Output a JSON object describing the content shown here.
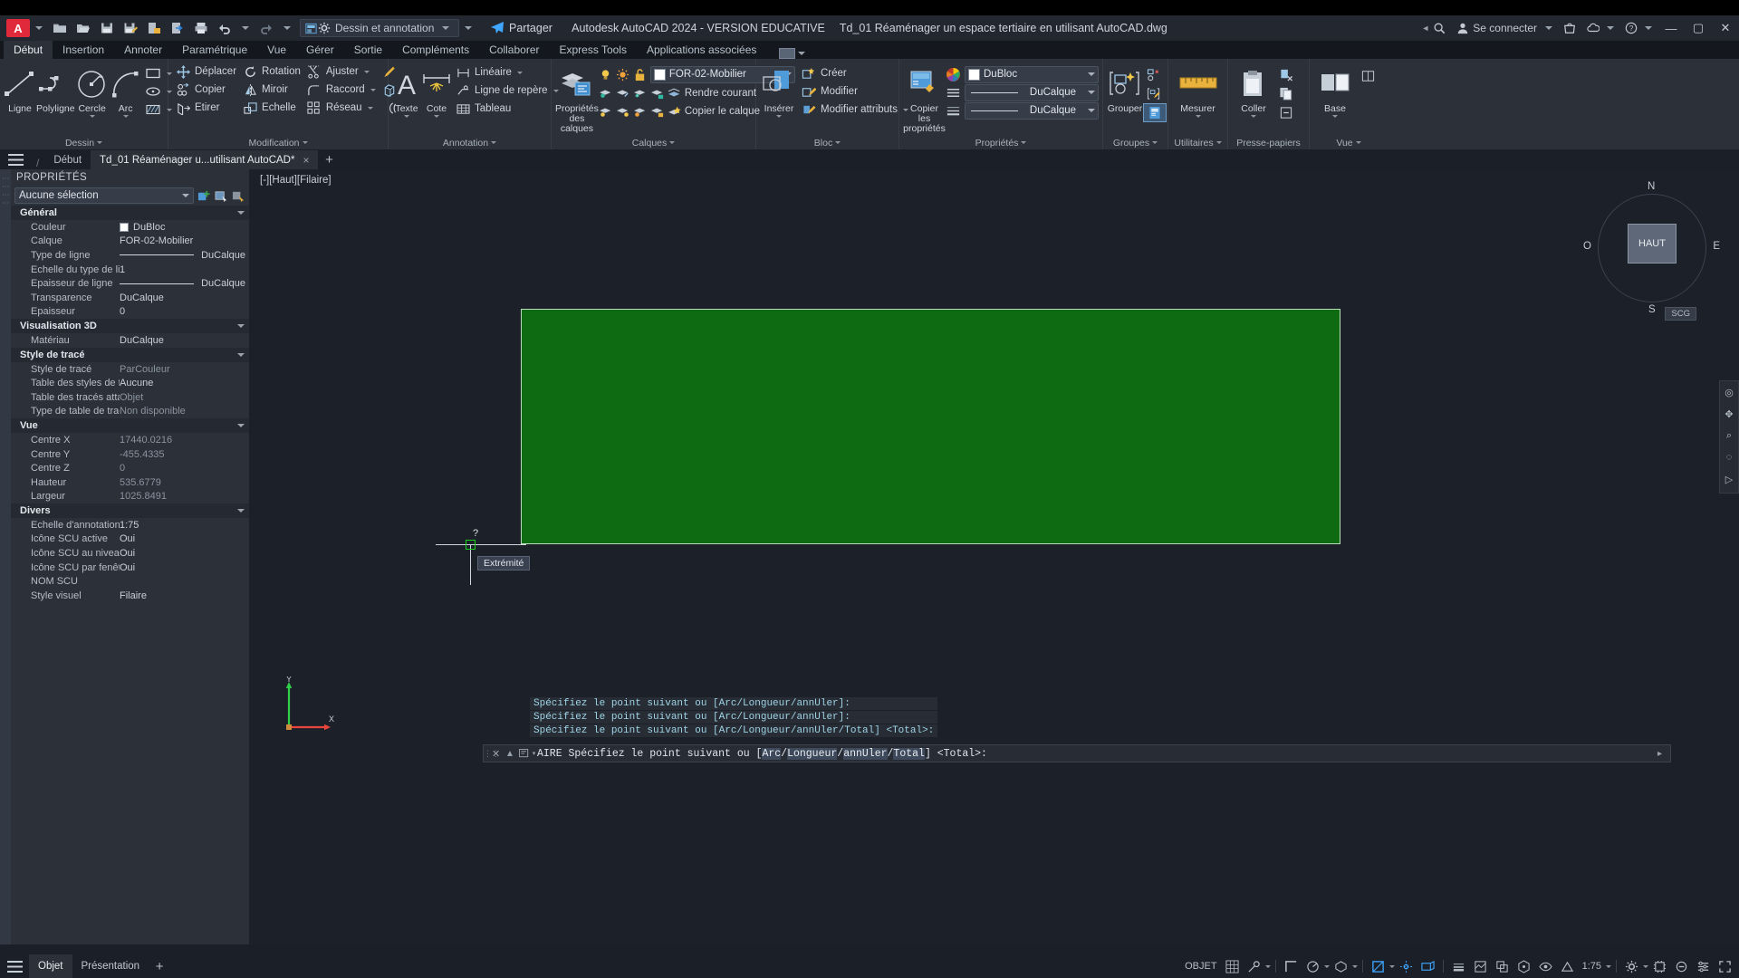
{
  "titlebar": {
    "app_letter": "A",
    "workspace": "Dessin et annotation",
    "share_label": "Partager",
    "app_title": "Autodesk AutoCAD 2024 - VERSION EDUCATIVE",
    "document_title": "Td_01 Réaménager un espace tertiaire en utilisant AutoCAD.dwg",
    "signin_label": "Se connecter",
    "quick_access": [
      "new-icon",
      "open-icon",
      "save-icon",
      "save-as-icon",
      "plot-preview-icon",
      "export-icon",
      "print-icon",
      "undo-icon",
      "redo-icon",
      "workspace-icon"
    ],
    "window_buttons": [
      "minimize",
      "maximize",
      "close"
    ]
  },
  "ribbon": {
    "tabs": [
      "Début",
      "Insertion",
      "Annoter",
      "Paramétrique",
      "Vue",
      "Gérer",
      "Sortie",
      "Compléments",
      "Collaborer",
      "Express Tools",
      "Applications associées"
    ],
    "active_tab": "Début",
    "panels": {
      "dessin": {
        "title": "Dessin",
        "big": [
          {
            "label": "Ligne",
            "icon": "line-icon"
          },
          {
            "label": "Polyligne",
            "icon": "polyline-icon"
          },
          {
            "label": "Cercle",
            "icon": "circle-icon"
          },
          {
            "label": "Arc",
            "icon": "arc-icon"
          }
        ],
        "small": [
          "rectangle-icon",
          "ellipse-icon",
          "hatch-icon"
        ]
      },
      "modification": {
        "title": "Modification",
        "items": [
          {
            "label": "Déplacer",
            "icon": "move-icon"
          },
          {
            "label": "Rotation",
            "icon": "rotate-icon"
          },
          {
            "label": "Ajuster",
            "icon": "trim-icon"
          },
          {
            "label": "Copier",
            "icon": "copy-icon"
          },
          {
            "label": "Miroir",
            "icon": "mirror-icon"
          },
          {
            "label": "Raccord",
            "icon": "fillet-icon"
          },
          {
            "label": "Etirer",
            "icon": "stretch-icon"
          },
          {
            "label": "Echelle",
            "icon": "scale-icon"
          },
          {
            "label": "Réseau",
            "icon": "array-icon"
          }
        ],
        "extras": [
          "brush-icon",
          "box-icon",
          "offset-icon"
        ]
      },
      "annotation": {
        "title": "Annotation",
        "big": [
          {
            "label": "Texte",
            "icon": "text-icon"
          },
          {
            "label": "Cote",
            "icon": "dimension-icon"
          }
        ],
        "items": [
          {
            "label": "Linéaire",
            "icon": "linear-dim-icon"
          },
          {
            "label": "Ligne de repère",
            "icon": "leader-icon"
          },
          {
            "label": "Tableau",
            "icon": "table-icon"
          }
        ]
      },
      "calques": {
        "title": "Calques",
        "big": {
          "label": "Propriétés\ndes calques",
          "label_l1": "Propriétés",
          "label_l2": "des calques",
          "icon": "layer-properties-icon"
        },
        "current_layer": "FOR-02-Mobilier",
        "items": [
          {
            "label": "Rendre courant",
            "icon": "make-current-icon"
          },
          {
            "label": "Copier le calque",
            "icon": "copy-layer-icon"
          }
        ]
      },
      "bloc": {
        "title": "Bloc",
        "big": {
          "label": "Insérer",
          "icon": "insert-block-icon"
        },
        "items": [
          {
            "label": "Créer",
            "icon": "create-block-icon"
          },
          {
            "label": "Modifier",
            "icon": "edit-block-icon"
          },
          {
            "label": "Modifier attributs",
            "icon": "edit-attributes-icon"
          }
        ]
      },
      "proprietes": {
        "title": "Propriétés",
        "big": {
          "label_l1": "Copier",
          "label_l2": "les propriétés",
          "icon": "match-properties-icon"
        },
        "color": "DuBloc",
        "linetype": "DuCalque",
        "lineweight": "DuCalque"
      },
      "groupes": {
        "title": "Groupes",
        "big": {
          "label": "Grouper",
          "icon": "group-icon"
        }
      },
      "utilitaires": {
        "title": "Utilitaires",
        "big": {
          "label": "Mesurer",
          "icon": "measure-icon"
        }
      },
      "presse_papiers": {
        "title": "Presse-papiers",
        "big": {
          "label": "Coller",
          "icon": "paste-icon"
        }
      },
      "vue": {
        "title": "Vue",
        "big": {
          "label": "Base",
          "icon": "base-view-icon"
        }
      }
    }
  },
  "filetabs": {
    "home_label": "Début",
    "tabs": [
      {
        "label": "Td_01 Réaménager u...utilisant AutoCAD*",
        "active": true,
        "close": "×"
      }
    ],
    "plus": "+"
  },
  "properties": {
    "panel_title": "PROPRIÉTÉS",
    "selection": "Aucune sélection",
    "groups": [
      {
        "name": "Général",
        "rows": [
          {
            "key": "Couleur",
            "value": "DuBloc",
            "swatch": "#ffffff"
          },
          {
            "key": "Calque",
            "value": "FOR-02-Mobilier"
          },
          {
            "key": "Type de ligne",
            "value": "DuCalque",
            "line": true
          },
          {
            "key": "Echelle du type de li...",
            "value": "1"
          },
          {
            "key": "Epaisseur de ligne",
            "value": "DuCalque",
            "line": true
          },
          {
            "key": "Transparence",
            "value": "DuCalque"
          },
          {
            "key": "Epaisseur",
            "value": "0"
          }
        ]
      },
      {
        "name": "Visualisation 3D",
        "rows": [
          {
            "key": "Matériau",
            "value": "DuCalque"
          }
        ]
      },
      {
        "name": "Style de tracé",
        "rows": [
          {
            "key": "Style de tracé",
            "value": "ParCouleur",
            "dim": true
          },
          {
            "key": "Table des styles de tr...",
            "value": "Aucune"
          },
          {
            "key": "Table des tracés atta...",
            "value": "Objet",
            "dim": true
          },
          {
            "key": "Type de table de tracé",
            "value": "Non disponible",
            "dim": true
          }
        ]
      },
      {
        "name": "Vue",
        "rows": [
          {
            "key": "Centre X",
            "value": "17440.0216",
            "dim": true
          },
          {
            "key": "Centre Y",
            "value": "-455.4335",
            "dim": true
          },
          {
            "key": "Centre Z",
            "value": "0",
            "dim": true
          },
          {
            "key": "Hauteur",
            "value": "535.6779",
            "dim": true
          },
          {
            "key": "Largeur",
            "value": "1025.8491",
            "dim": true
          }
        ]
      },
      {
        "name": "Divers",
        "rows": [
          {
            "key": "Echelle d'annotation",
            "value": "1:75"
          },
          {
            "key": "Icône SCU active",
            "value": "Oui"
          },
          {
            "key": "Icône SCU au niveau...",
            "value": "Oui"
          },
          {
            "key": "Icône SCU par fenêtre",
            "value": "Oui"
          },
          {
            "key": "NOM SCU",
            "value": ""
          },
          {
            "key": "Style visuel",
            "value": "Filaire"
          }
        ]
      }
    ]
  },
  "canvas": {
    "viewport_label": "[-][Haut][Filaire]",
    "rectangle_color": "#0e6b12",
    "rectangle_border": "#b9ddb9",
    "osnap_tooltip": "Extrémité",
    "cursor_marker": "?",
    "viewcube": {
      "top_face": "HAUT",
      "north": "N",
      "south": "S",
      "west": "O",
      "east": "E",
      "ucs_badge": "SCG"
    },
    "ucs_axes": {
      "x": "X",
      "y": "Y"
    }
  },
  "command": {
    "history": [
      "Spécifiez le point suivant ou [Arc/Longueur/annUler]:",
      "Spécifiez le point suivant ou [Arc/Longueur/annUler]:",
      "Spécifiez le point suivant ou [Arc/Longueur/annUler/Total] <Total>:"
    ],
    "prompt_prefix": "AIRE Spécifiez le point suivant ou [",
    "option_arc": "Arc",
    "sep1": "/",
    "option_longueur": "Longueur",
    "sep2": "/",
    "option_annuler": "annUler",
    "sep3": "/",
    "option_total": "Total",
    "prompt_suffix": "] <Total>:"
  },
  "statusbar": {
    "left_tabs": [
      {
        "label": "Objet",
        "active": true
      },
      {
        "label": "Présentation",
        "active": false
      }
    ],
    "plus": "+",
    "model_label": "OBJET",
    "annotation_scale": "1:75",
    "icons": [
      "grid-icon",
      "snap-icon",
      "ortho-icon",
      "polar-icon",
      "osnap-icon",
      "otrack-icon",
      "lineweight-icon",
      "transparency-icon",
      "selection-cycling-icon",
      "3d-osnap-icon",
      "dynamic-ucs-icon",
      "annotation-visibility-icon",
      "workspace-switch-icon",
      "hardware-accel-icon",
      "isolate-objects-icon",
      "customization-icon",
      "fullscreen-icon"
    ]
  },
  "colors": {
    "accent": "#3fa7ff",
    "logo_red": "#e02a3c",
    "ribbon_bg": "#2b3039",
    "canvas_bg": "#1c2028",
    "green_fill": "#0e6b12",
    "snap_green": "#19d219"
  }
}
